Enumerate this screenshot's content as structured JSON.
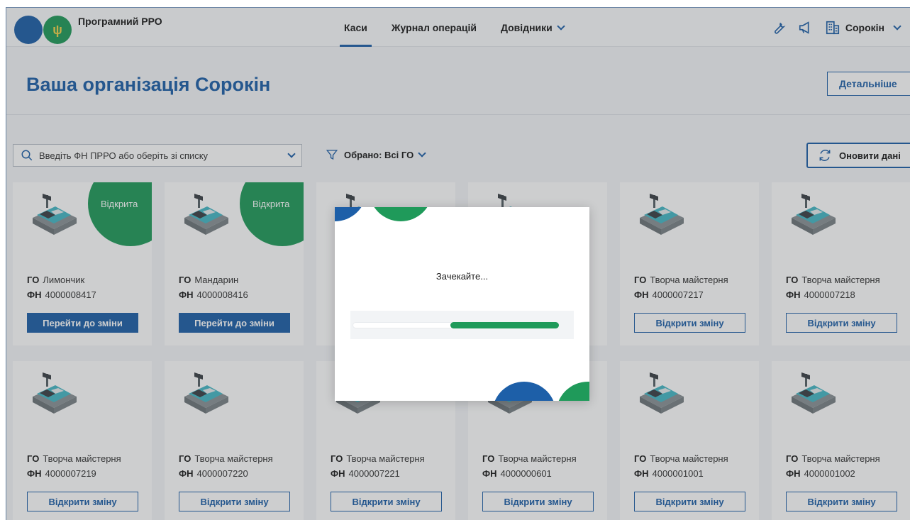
{
  "header": {
    "logo_text": "Програмний РРО",
    "nav": [
      {
        "label": "Каси",
        "active": true
      },
      {
        "label": "Журнал операцій",
        "active": false
      },
      {
        "label": "Довідники",
        "active": false,
        "dropdown": true
      }
    ],
    "icons": [
      "wrench-icon",
      "megaphone-icon",
      "organization-icon"
    ],
    "user_name": "Сорокін"
  },
  "org": {
    "title": "Ваша організація Сорокін",
    "details_label": "Детальніше"
  },
  "toolbar": {
    "search_placeholder": "Введіть ФН ПРРО або оберіть зі списку",
    "filter_label": "Обрано: Всі ГО",
    "refresh_label": "Оновити дані"
  },
  "labels": {
    "go": "ГО",
    "fn": "ФН"
  },
  "cards": [
    {
      "go": "Лимончик",
      "fn": "4000008417",
      "status": "Відкрита",
      "action": "Перейти до зміни",
      "primary": true
    },
    {
      "go": "Мандарин",
      "fn": "4000008416",
      "status": "Відкрита",
      "action": "Перейти до зміни",
      "primary": true
    },
    {
      "go": "",
      "fn": "",
      "status": "",
      "action": "",
      "primary": false
    },
    {
      "go": "",
      "fn": "",
      "status": "",
      "action": "",
      "primary": false
    },
    {
      "go": "Творча майстерня",
      "fn": "4000007217",
      "status": "",
      "action": "Відкрити зміну",
      "primary": false
    },
    {
      "go": "Творча майстерня",
      "fn": "4000007218",
      "status": "",
      "action": "Відкрити зміну",
      "primary": false
    },
    {
      "go": "Творча майстерня",
      "fn": "4000007219",
      "status": "",
      "action": "Відкрити зміну",
      "primary": false
    },
    {
      "go": "Творча майстерня",
      "fn": "4000007220",
      "status": "",
      "action": "Відкрити зміну",
      "primary": false
    },
    {
      "go": "Творча майстерня",
      "fn": "4000007221",
      "status": "",
      "action": "Відкрити зміну",
      "primary": false
    },
    {
      "go": "Творча майстерня",
      "fn": "4000000601",
      "status": "",
      "action": "Відкрити зміну",
      "primary": false
    },
    {
      "go": "Творча майстерня",
      "fn": "4000001001",
      "status": "",
      "action": "Відкрити зміну",
      "primary": false
    },
    {
      "go": "Творча майстерня",
      "fn": "4000001002",
      "status": "",
      "action": "Відкрити зміну",
      "primary": false
    }
  ],
  "dialog": {
    "message": "Зачекайте...",
    "progress": 0.5
  },
  "colors": {
    "primary": "#1d5fa8",
    "accent": "#1f9a5a"
  }
}
